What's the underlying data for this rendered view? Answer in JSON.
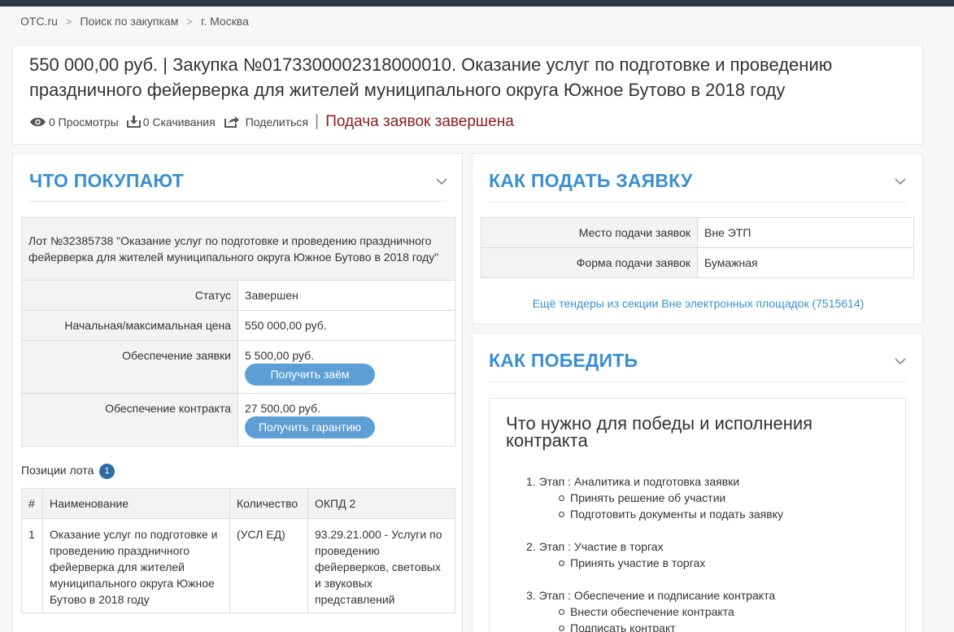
{
  "breadcrumbs": [
    "OTC.ru",
    "Поиск по закупкам",
    "г. Москва"
  ],
  "header": {
    "title": "550 000,00 руб. | Закупка №0173300002318000010. Оказание услуг по подготовке и проведению праздничного фейерверка для жителей муниципального округа Южное Бутово в 2018 году",
    "views": "0 Просмотры",
    "downloads": "0 Скачивания",
    "share": "Поделиться",
    "status": "Подача заявок завершена"
  },
  "buy": {
    "title": "ЧТО ПОКУПАЮТ",
    "lot_title": "Лот №32385738 \"Оказание услуг по подготовке и проведению праздничного фейерверка для жителей муниципального округа Южное Бутово в 2018 году\"",
    "status_label": "Статус",
    "status_value": "Завершен",
    "price_label": "Начальная/максимальная цена",
    "price_value": "550 000,00 руб.",
    "bid_sec_label": "Обеспечение заявки",
    "bid_sec_value": "5 500,00 руб.",
    "loan_button": "Получить заём",
    "contract_sec_label": "Обеспечение контракта",
    "contract_sec_value": "27 500,00 руб.",
    "guarantee_button": "Получить гарантию",
    "positions_label": "Позиции лота",
    "positions_count": "1",
    "columns": [
      "#",
      "Наименование",
      "Количество",
      "ОКПД 2"
    ],
    "rows": [
      [
        "1",
        "Оказание услуг по подготовке и проведению праздничного фейерверка для жителей муниципального округа Южное Бутово в 2018 году",
        "(УСЛ ЕД)",
        "93.29.21.000 - Услуги по проведению фейерверков, световых и звуковых представлений"
      ]
    ]
  },
  "apply": {
    "title": "КАК ПОДАТЬ ЗАЯВКУ",
    "place_label": "Место подачи заявок",
    "place_value": "Вне ЭТП",
    "form_label": "Форма подачи заявок",
    "form_value": "Бумажная",
    "more_link": "Ещё тендеры из секции Вне электронных площадок (7515614)"
  },
  "win": {
    "title": "КАК ПОБЕДИТЬ",
    "subtitle": "Что нужно для победы и исполнения контракта",
    "stages": [
      {
        "label": "1. Этап : Аналитика и подготовка заявки",
        "items": [
          "Принять решение об участии",
          "Подготовить документы и подать заявку"
        ]
      },
      {
        "label": "2. Этап : Участие в торгах",
        "items": [
          "Принять участие в торгах"
        ]
      },
      {
        "label": "3. Этап : Обеспечение и подписание контракта",
        "items": [
          "Внести обеспечение контракта",
          "Подписать контракт"
        ]
      }
    ]
  },
  "icons": [
    "eye-icon",
    "download-icon",
    "share-icon",
    "chevron-down-icon"
  ],
  "colors": {
    "accent": "#3a8fd0",
    "status": "#8b1c1c",
    "button": "#5d9fd5",
    "badge": "#2e6da4",
    "topbar": "#2c3a46"
  }
}
